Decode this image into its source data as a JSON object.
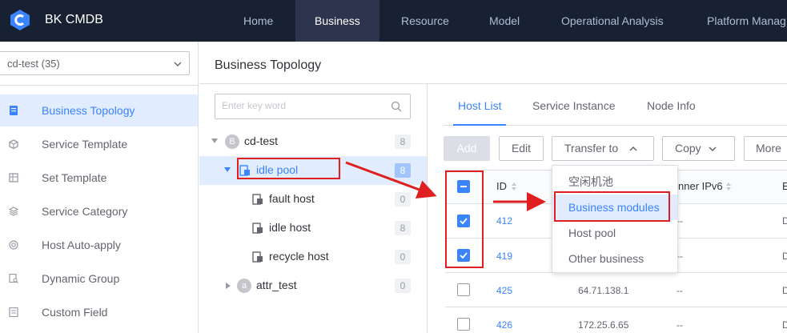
{
  "nav": {
    "brand": "BK CMDB",
    "items": [
      {
        "label": "Home"
      },
      {
        "label": "Business"
      },
      {
        "label": "Resource"
      },
      {
        "label": "Model"
      },
      {
        "label": "Operational Analysis"
      },
      {
        "label": "Platform Manag"
      }
    ],
    "active": "Business"
  },
  "sidebar": {
    "business_select": "cd-test (35)",
    "items": [
      {
        "label": "Business Topology"
      },
      {
        "label": "Service Template"
      },
      {
        "label": "Set Template"
      },
      {
        "label": "Service Category"
      },
      {
        "label": "Host Auto-apply"
      },
      {
        "label": "Dynamic Group"
      },
      {
        "label": "Custom Field"
      }
    ]
  },
  "page": {
    "title": "Business Topology"
  },
  "topology": {
    "search_placeholder": "Enter key word",
    "nodes": [
      {
        "badge": "B",
        "label": "cd-test",
        "count": "8"
      },
      {
        "label": "idle pool",
        "count": "8"
      },
      {
        "label": "fault host",
        "count": "0"
      },
      {
        "label": "idle host",
        "count": "8"
      },
      {
        "label": "recycle host",
        "count": "0"
      },
      {
        "badge": "a",
        "label": "attr_test",
        "count": "0"
      }
    ]
  },
  "tabs": [
    {
      "label": "Host List"
    },
    {
      "label": "Service Instance"
    },
    {
      "label": "Node Info"
    }
  ],
  "toolbar": {
    "add": "Add",
    "edit": "Edit",
    "transfer": "Transfer to",
    "copy": "Copy",
    "more": "More"
  },
  "table": {
    "headers": {
      "id": "ID",
      "ipv6": "nner IPv6",
      "extra": "E"
    },
    "rows": [
      {
        "id": "412",
        "ip": "",
        "ipv6": "--",
        "extra": "D",
        "checked": true
      },
      {
        "id": "419",
        "ip": "",
        "ipv6": "--",
        "extra": "D",
        "checked": true
      },
      {
        "id": "425",
        "ip": "64.71.138.1",
        "ipv6": "--",
        "extra": "D",
        "checked": false
      },
      {
        "id": "426",
        "ip": "172.25.6.65",
        "ipv6": "--",
        "extra": "D",
        "checked": false
      }
    ]
  },
  "transfer_menu": {
    "items": [
      {
        "label": "空闲机池"
      },
      {
        "label": "Business modules"
      },
      {
        "label": "Host pool"
      },
      {
        "label": "Other business"
      }
    ],
    "highlighted": "Business modules"
  },
  "colors": {
    "nav_bg": "#182132",
    "primary": "#3a84ff",
    "annotation": "#e02020"
  }
}
